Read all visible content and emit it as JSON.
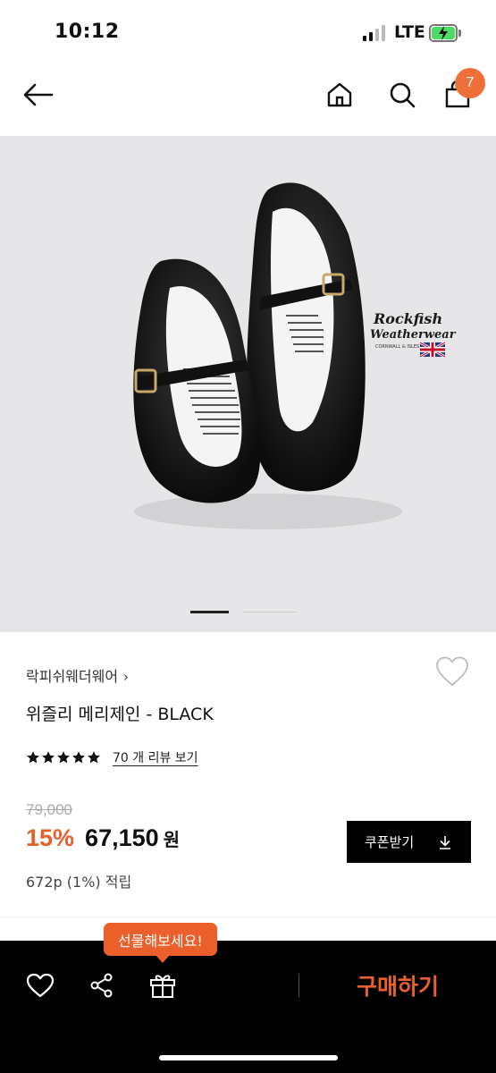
{
  "status": {
    "time": "10:12",
    "network": "LTE"
  },
  "nav": {
    "cart_count": "7"
  },
  "hero": {
    "brand_logo_line1": "Rockfish",
    "brand_logo_line2": "Weatherwear",
    "brand_logo_line3": "CORNWALL & ISLES OF SCILLY",
    "slide_index": 1,
    "slide_count": 2
  },
  "product": {
    "brand": "락피쉬웨더웨어",
    "brand_chevron": "›",
    "title": "위즐리 메리제인 - BLACK",
    "rating": 5,
    "review_link": "70 개 리뷰 보기",
    "original_price": "79,000",
    "discount": "15%",
    "sale_price": "67,150",
    "currency": "원",
    "coupon_label": "쿠폰받기",
    "points": "672p (1%) 적립"
  },
  "bottom": {
    "gift_tooltip": "선물해보세요!",
    "buy_label": "구매하기"
  },
  "colors": {
    "accent": "#ea5f2a",
    "badge": "#ef6f3b"
  }
}
